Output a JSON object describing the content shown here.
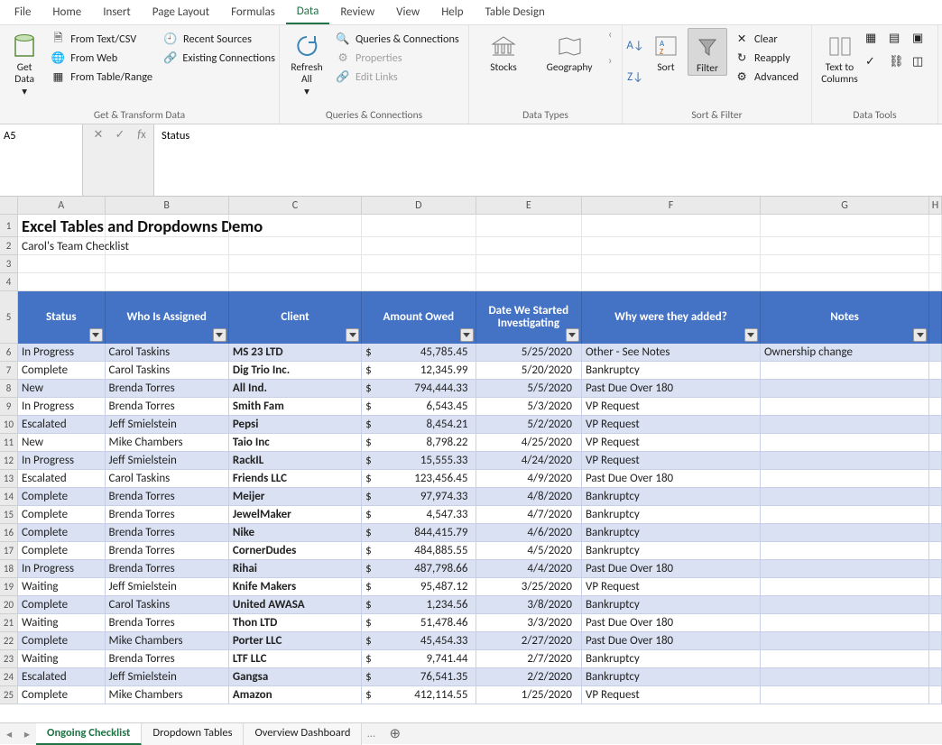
{
  "menu": {
    "items": [
      "File",
      "Home",
      "Insert",
      "Page Layout",
      "Formulas",
      "Data",
      "Review",
      "View",
      "Help",
      "Table Design"
    ],
    "active": "Data"
  },
  "ribbon": {
    "get_transform": {
      "big": "Get\nData",
      "items": [
        "From Text/CSV",
        "From Web",
        "From Table/Range",
        "Recent Sources",
        "Existing Connections"
      ],
      "label": "Get & Transform Data"
    },
    "queries": {
      "big": "Refresh\nAll",
      "items": [
        "Queries & Connections",
        "Properties",
        "Edit Links"
      ],
      "disabled_items": [
        "Properties",
        "Edit Links"
      ],
      "label": "Queries & Connections"
    },
    "datatypes": {
      "items": [
        "Stocks",
        "Geography"
      ],
      "label": "Data Types"
    },
    "sortfilter": {
      "sort": "Sort",
      "filter": "Filter",
      "side": [
        "Clear",
        "Reapply",
        "Advanced"
      ],
      "label": "Sort & Filter"
    },
    "datatools": {
      "big": "Text to\nColumns",
      "label": "Data Tools"
    }
  },
  "name_box": "A5",
  "formula": "Status",
  "columns": [
    "A",
    "B",
    "C",
    "D",
    "E",
    "F",
    "G",
    "H"
  ],
  "title": "Excel Tables and Dropdowns Demo",
  "subtitle": "Carol's Team Checklist",
  "headers": [
    "Status",
    "Who Is Assigned",
    "Client",
    "Amount Owed",
    "Date We Started Investigating",
    "Why were they added?",
    "Notes"
  ],
  "rows": [
    {
      "n": 6,
      "status": "In Progress",
      "who": "Carol Taskins",
      "client": "MS 23 LTD",
      "amt": "45,785.45",
      "date": "5/25/2020",
      "why": "Other - See Notes",
      "notes": "Ownership change"
    },
    {
      "n": 7,
      "status": "Complete",
      "who": "Carol Taskins",
      "client": "Dig Trio Inc.",
      "amt": "12,345.99",
      "date": "5/20/2020",
      "why": "Bankruptcy",
      "notes": ""
    },
    {
      "n": 8,
      "status": "New",
      "who": "Brenda Torres",
      "client": "All Ind.",
      "amt": "794,444.33",
      "date": "5/5/2020",
      "why": "Past Due Over 180",
      "notes": ""
    },
    {
      "n": 9,
      "status": "In Progress",
      "who": "Brenda Torres",
      "client": "Smith Fam",
      "amt": "6,543.45",
      "date": "5/3/2020",
      "why": "VP Request",
      "notes": ""
    },
    {
      "n": 10,
      "status": "Escalated",
      "who": "Jeff Smielstein",
      "client": "Pepsi",
      "amt": "8,454.21",
      "date": "5/2/2020",
      "why": "VP Request",
      "notes": ""
    },
    {
      "n": 11,
      "status": "New",
      "who": "Mike Chambers",
      "client": "Taio Inc",
      "amt": "8,798.22",
      "date": "4/25/2020",
      "why": "VP Request",
      "notes": ""
    },
    {
      "n": 12,
      "status": "In Progress",
      "who": "Jeff Smielstein",
      "client": "RackIL",
      "amt": "15,555.33",
      "date": "4/24/2020",
      "why": "VP Request",
      "notes": ""
    },
    {
      "n": 13,
      "status": "Escalated",
      "who": "Carol Taskins",
      "client": "Friends LLC",
      "amt": "123,456.45",
      "date": "4/9/2020",
      "why": "Past Due Over 180",
      "notes": ""
    },
    {
      "n": 14,
      "status": "Complete",
      "who": "Brenda Torres",
      "client": "Meijer",
      "amt": "97,974.33",
      "date": "4/8/2020",
      "why": "Bankruptcy",
      "notes": ""
    },
    {
      "n": 15,
      "status": "Complete",
      "who": "Brenda Torres",
      "client": "JewelMaker",
      "amt": "4,547.33",
      "date": "4/7/2020",
      "why": "Bankruptcy",
      "notes": ""
    },
    {
      "n": 16,
      "status": "Complete",
      "who": "Brenda Torres",
      "client": "Nike",
      "amt": "844,415.79",
      "date": "4/6/2020",
      "why": "Bankruptcy",
      "notes": ""
    },
    {
      "n": 17,
      "status": "Complete",
      "who": "Brenda Torres",
      "client": "CornerDudes",
      "amt": "484,885.55",
      "date": "4/5/2020",
      "why": "Bankruptcy",
      "notes": ""
    },
    {
      "n": 18,
      "status": "In Progress",
      "who": "Brenda Torres",
      "client": "Rihai",
      "amt": "487,798.66",
      "date": "4/4/2020",
      "why": "Past Due Over 180",
      "notes": ""
    },
    {
      "n": 19,
      "status": "Waiting",
      "who": "Jeff Smielstein",
      "client": "Knife Makers",
      "amt": "95,487.12",
      "date": "3/25/2020",
      "why": "VP Request",
      "notes": ""
    },
    {
      "n": 20,
      "status": "Complete",
      "who": "Carol Taskins",
      "client": "United AWASA",
      "amt": "1,234.56",
      "date": "3/8/2020",
      "why": "Bankruptcy",
      "notes": ""
    },
    {
      "n": 21,
      "status": "Waiting",
      "who": "Brenda Torres",
      "client": "Thon LTD",
      "amt": "51,478.46",
      "date": "3/3/2020",
      "why": "Past Due Over 180",
      "notes": ""
    },
    {
      "n": 22,
      "status": "Complete",
      "who": "Mike Chambers",
      "client": "Porter LLC",
      "amt": "45,454.33",
      "date": "2/27/2020",
      "why": "Past Due Over 180",
      "notes": ""
    },
    {
      "n": 23,
      "status": "Waiting",
      "who": "Brenda Torres",
      "client": "LTF LLC",
      "amt": "9,741.44",
      "date": "2/7/2020",
      "why": "Bankruptcy",
      "notes": ""
    },
    {
      "n": 24,
      "status": "Escalated",
      "who": "Jeff Smielstein",
      "client": "Gangsa",
      "amt": "76,541.35",
      "date": "2/2/2020",
      "why": "Bankruptcy",
      "notes": ""
    },
    {
      "n": 25,
      "status": "Complete",
      "who": "Mike Chambers",
      "client": "Amazon",
      "amt": "412,114.55",
      "date": "1/25/2020",
      "why": "VP Request",
      "notes": ""
    }
  ],
  "sheets": {
    "tabs": [
      "Ongoing Checklist",
      "Dropdown Tables",
      "Overview Dashboard"
    ],
    "active": "Ongoing Checklist",
    "more": "…"
  }
}
